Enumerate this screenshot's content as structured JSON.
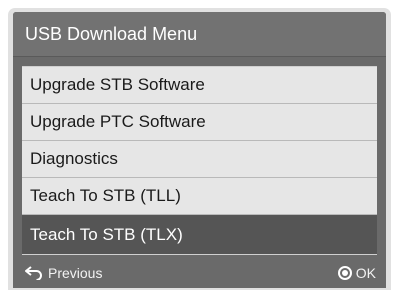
{
  "window": {
    "title": "USB Download Menu"
  },
  "menu": {
    "items": [
      {
        "label": "Upgrade STB Software",
        "selected": false
      },
      {
        "label": "Upgrade PTC Software",
        "selected": false
      },
      {
        "label": "Diagnostics",
        "selected": false
      },
      {
        "label": "Teach To STB (TLL)",
        "selected": false
      },
      {
        "label": "Teach To STB (TLX)",
        "selected": true
      }
    ]
  },
  "footer": {
    "back_label": "Previous",
    "back_icon": "return-arrow-icon",
    "ok_label": "OK",
    "ok_icon": "ok-button-icon"
  },
  "colors": {
    "panel": "#6a6a6a",
    "menu_background": "#e6e6e6",
    "selected_background": "#555555",
    "text_dark": "#1a1a1a",
    "text_light": "#ffffff"
  }
}
